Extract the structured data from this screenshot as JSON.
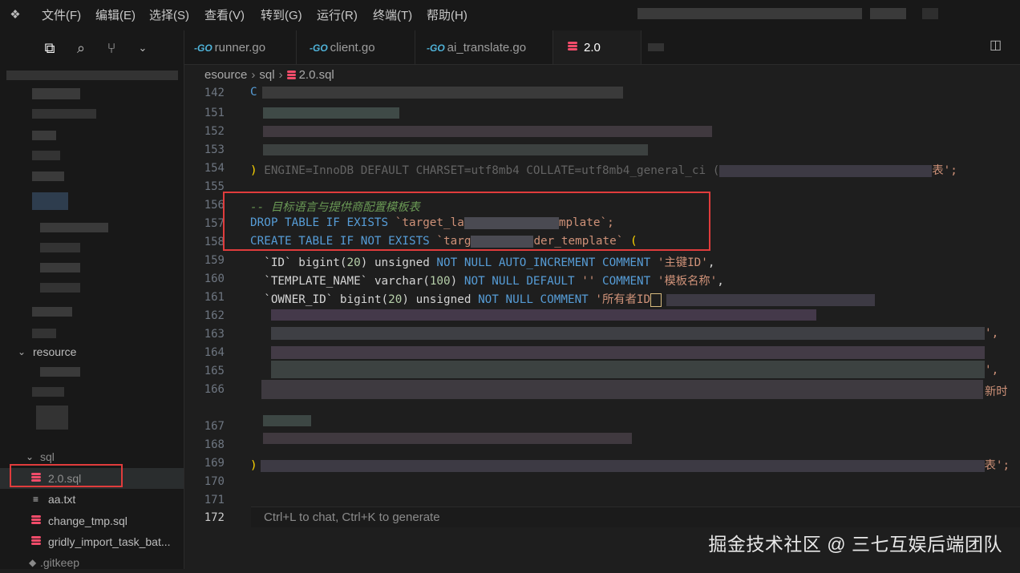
{
  "menu": {
    "items": [
      "文件(F)",
      "编辑(E)",
      "选择(S)",
      "查看(V)",
      "转到(G)",
      "运行(R)",
      "终端(T)",
      "帮助(H)"
    ]
  },
  "tabs": [
    {
      "label": "runner.go",
      "type": "go"
    },
    {
      "label": "client.go",
      "type": "go"
    },
    {
      "label": "ai_translate.go",
      "type": "go"
    },
    {
      "label": "2.0",
      "type": "sql"
    }
  ],
  "breadcrumb": [
    "esource",
    "sql",
    "2.0.sql"
  ],
  "explorer": {
    "resource_folder": "resource",
    "sql_folder": "sql",
    "files": [
      {
        "label": "2.0.sql",
        "type": "sql",
        "selected": true
      },
      {
        "label": "aa.txt",
        "type": "txt"
      },
      {
        "label": "change_tmp.sql",
        "type": "sql"
      },
      {
        "label": "gridly_import_task_bat...",
        "type": "sql"
      },
      {
        "label": ".gitkeep",
        "type": "git"
      }
    ]
  },
  "editor": {
    "current_line": "172",
    "line_numbers": [
      "142",
      "151",
      "152",
      "153",
      "154",
      "155",
      "156",
      "157",
      "158",
      "159",
      "160",
      "161",
      "162",
      "163",
      "164",
      "165",
      "166",
      "167",
      "168",
      "169",
      "170",
      "171",
      "172"
    ],
    "lines": {
      "l142": "C",
      "l154_a": ") ENGINE=InnoDB DEFAULT CHARSET=utf8mb4 COLLATE=utf8mb4_general_ci (",
      "l154_b": "表';",
      "l156": "-- 目标语言与提供商配置模板表",
      "l157_a": "DROP TABLE IF EXISTS ",
      "l157_b": "`target_la",
      "l157_c": "mplate`;",
      "l158_a": "CREATE TABLE IF NOT EXISTS ",
      "l158_b": "`targ",
      "l158_c": "der_template` ",
      "l158_d": "(",
      "l159_a": "`ID` bigint(",
      "l159_n": "20",
      "l159_b": ") unsigned ",
      "l159_c": "NOT NULL AUTO_INCREMENT COMMENT ",
      "l159_d": "'主键ID'",
      "l159_e": ",",
      "l160_a": "`TEMPLATE_NAME` varchar(",
      "l160_n": "100",
      "l160_b": ") ",
      "l160_c": "NOT NULL DEFAULT ",
      "l160_d": "''",
      "l160_e": " COMMENT ",
      "l160_f": "'模板名称'",
      "l160_g": ",",
      "l161_a": "`OWNER_ID` bigint(",
      "l161_n": "20",
      "l161_b": ") unsigned ",
      "l161_c": "NOT NULL COMMENT ",
      "l161_d": "'所有者ID",
      "l163_end": "',",
      "l165_end": "',",
      "l166_end": "新时",
      "l169_a": ")",
      "l169_b": "表';"
    },
    "hint": "Ctrl+L to chat, Ctrl+K to generate"
  },
  "watermark": "掘金技术社区 @ 三七互娱后端团队",
  "colors": {
    "highlight_box": "#e03c3c",
    "sql_icon": "#f14c6a",
    "go_icon": "#4fb3d9",
    "keyword": "#569cd6",
    "string": "#ce9178"
  }
}
